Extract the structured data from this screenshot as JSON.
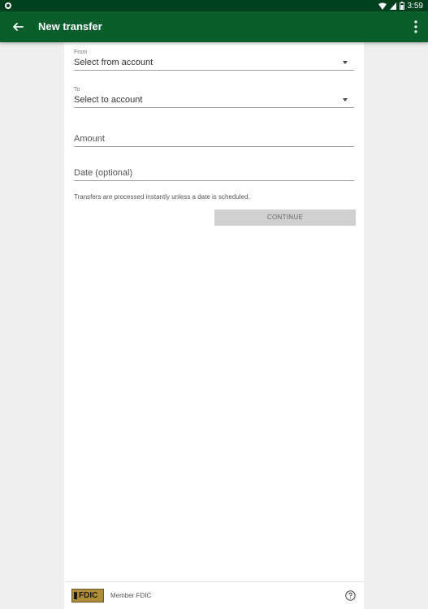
{
  "status_bar": {
    "time": "3:59"
  },
  "app_bar": {
    "title": "New transfer",
    "back_icon": "back-arrow-icon",
    "more_icon": "more-vert-icon"
  },
  "form": {
    "from": {
      "label": "From",
      "placeholder": "Select from account"
    },
    "to": {
      "label": "To",
      "placeholder": "Select to account"
    },
    "amount": {
      "placeholder": "Amount"
    },
    "date": {
      "placeholder": "Date (optional)"
    },
    "note": "Transfers are processed instantly unless a date is scheduled.",
    "continue_label": "CONTINUE"
  },
  "footer": {
    "logo_text": "FDIC",
    "member_text": "Member FDIC",
    "help_icon": "help-icon"
  },
  "colors": {
    "status_bar": "#00401f",
    "app_bar": "#0a5e2c",
    "button_disabled": "#d0d0d0"
  }
}
